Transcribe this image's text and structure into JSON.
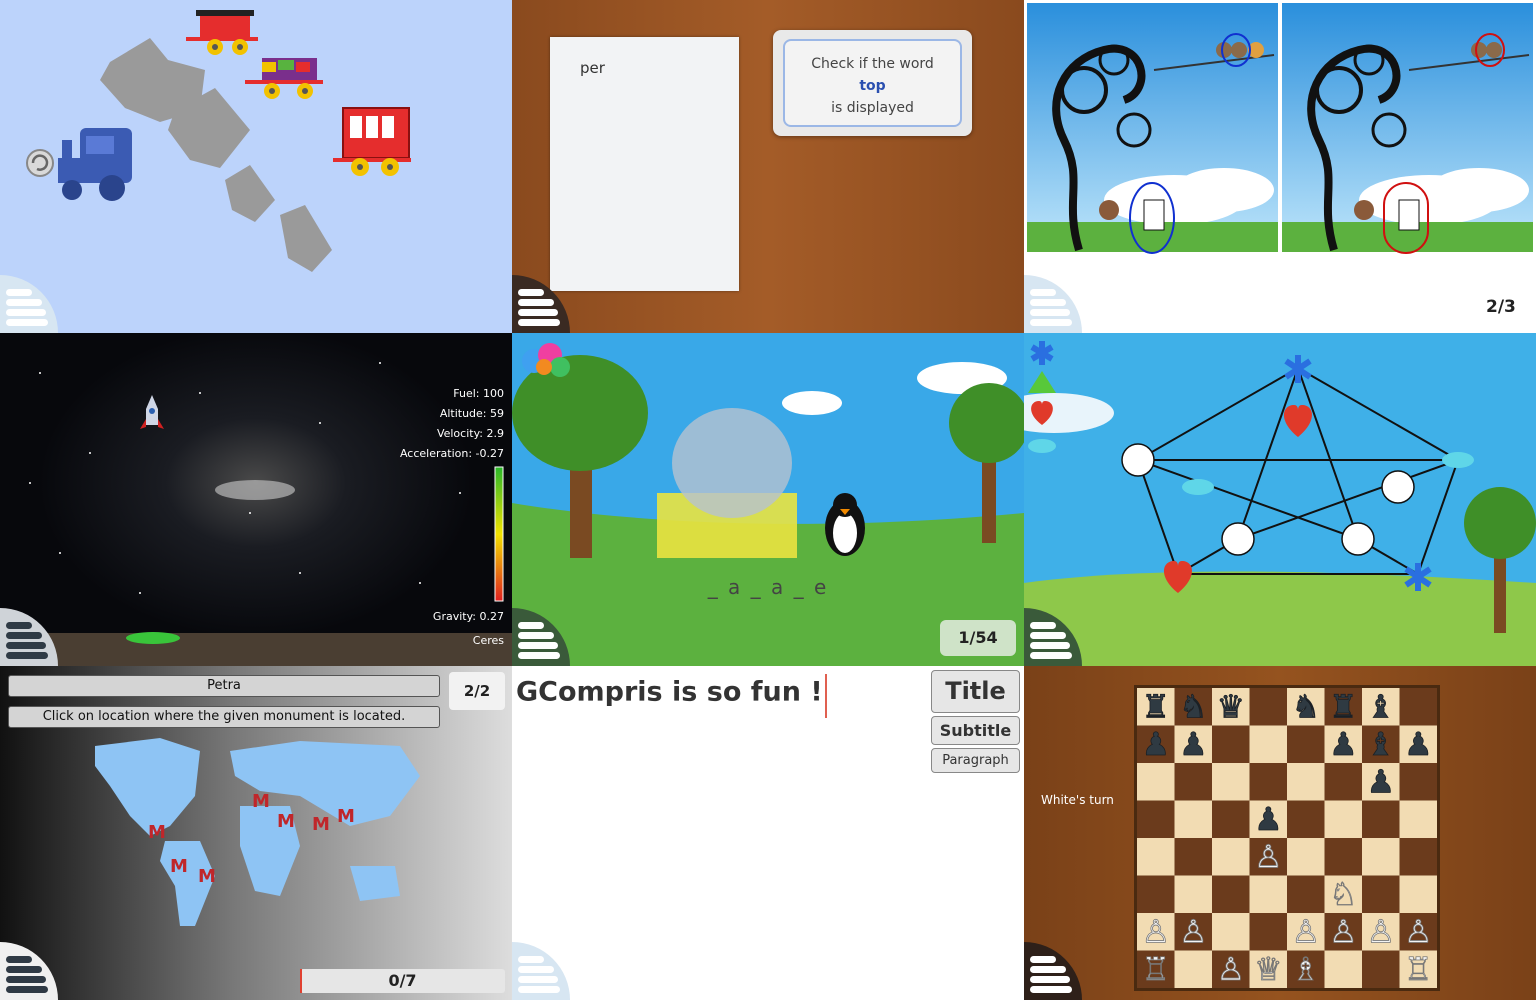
{
  "colors": {
    "sky_blue": "#bcd3fb",
    "wood": "#8b4a1f",
    "space": "#0a0c12",
    "meadow_sky": "#39a8e8",
    "grass": "#5cb13f",
    "graph_sky": "#3fb0e8",
    "map_ocean": "#8d8d8d",
    "land": "#8ec4f4",
    "chess_dark": "#6b3b1c",
    "chess_light": "#f2dcb3"
  },
  "word_check": {
    "card_text": "per",
    "prompt_line1": "Check if the word",
    "prompt_word": "top",
    "prompt_line2": "is displayed"
  },
  "differences": {
    "counter": "2/3"
  },
  "lander": {
    "fuel": "Fuel: 100",
    "altitude": "Altitude: 59",
    "velocity": "Velocity: 2.9",
    "acceleration": "Acceleration: -0.27",
    "gravity": "Gravity: 0.27",
    "planet": "Ceres"
  },
  "hangman": {
    "hint": "_ a _ a _ e",
    "counter": "1/54"
  },
  "geography": {
    "monument": "Petra",
    "counter": "2/2",
    "instruction": "Click on location where the given monument is located.",
    "score": "0/7",
    "marker": "M"
  },
  "editor": {
    "text": "GCompris is so fun !",
    "buttons": {
      "title": "Title",
      "subtitle": "Subtitle",
      "paragraph": "Paragraph"
    }
  },
  "chess": {
    "status": "White's turn"
  }
}
